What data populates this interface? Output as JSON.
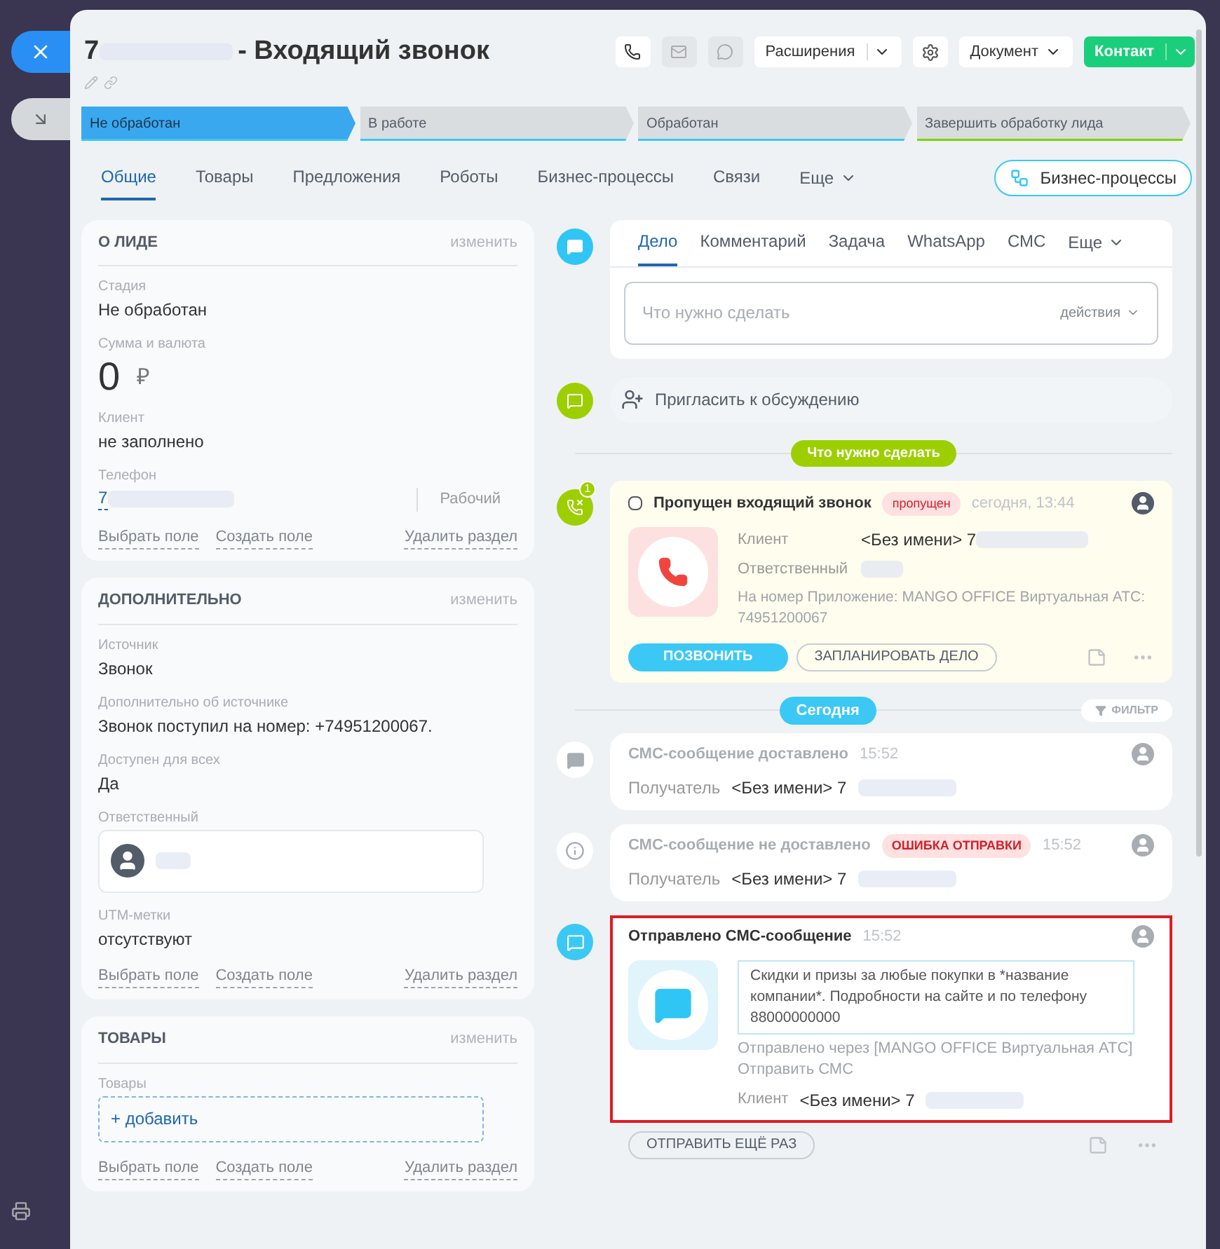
{
  "header": {
    "title_number": "7",
    "title": "- Входящий звонок",
    "extensions": "Расширения",
    "document": "Документ",
    "contact": "Контакт"
  },
  "stages": [
    {
      "label": "Не обработан",
      "selected": true,
      "color": "#3bc8f5"
    },
    {
      "label": "В работе",
      "selected": false,
      "color": "#3bc8f5"
    },
    {
      "label": "Обработан",
      "selected": false,
      "color": "#3bc8f5"
    },
    {
      "label": "Завершить обработку лида",
      "selected": false,
      "color": "#7bd500"
    }
  ],
  "tabs": [
    {
      "label": "Общие",
      "selected": true
    },
    {
      "label": "Товары",
      "selected": false
    },
    {
      "label": "Предложения",
      "selected": false
    },
    {
      "label": "Роботы",
      "selected": false
    },
    {
      "label": "Бизнес-процессы",
      "selected": false
    },
    {
      "label": "Связи",
      "selected": false
    }
  ],
  "tabs_more": "Еще",
  "bp_button": "Бизнес-процессы",
  "sections": [
    {
      "title": "О ЛИДЕ",
      "edit": "изменить",
      "fields": [
        {
          "kind": "text",
          "label": "Стадия",
          "value": "Не обработан"
        },
        {
          "kind": "money",
          "label": "Сумма и валюта",
          "value": "0",
          "currency": "₽"
        },
        {
          "kind": "text",
          "label": "Клиент",
          "value": "не заполнено"
        },
        {
          "kind": "phone",
          "label": "Телефон",
          "value": "7",
          "type": "Рабочий"
        }
      ],
      "footer": [
        "Выбрать поле",
        "Создать поле",
        "Удалить раздел"
      ]
    },
    {
      "title": "ДОПОЛНИТЕЛЬНО",
      "edit": "изменить",
      "fields": [
        {
          "kind": "text",
          "label": "Источник",
          "value": "Звонок"
        },
        {
          "kind": "text",
          "label": "Дополнительно об источнике",
          "value": "Звонок поступил на номер: +74951200067."
        },
        {
          "kind": "text",
          "label": "Доступен для всех",
          "value": "Да"
        },
        {
          "kind": "user",
          "label": "Ответственный"
        },
        {
          "kind": "text",
          "label": "UTM-метки",
          "value": "отсутствуют"
        }
      ],
      "footer": [
        "Выбрать поле",
        "Создать поле",
        "Удалить раздел"
      ]
    },
    {
      "title": "ТОВАРЫ",
      "edit": "изменить",
      "fields": [
        {
          "kind": "products",
          "label": "Товары",
          "value": "+ добавить"
        }
      ],
      "footer": [
        "Выбрать поле",
        "Создать поле",
        "Удалить раздел"
      ]
    }
  ],
  "composer": {
    "tabs": [
      {
        "label": "Дело",
        "selected": true
      },
      {
        "label": "Комментарий",
        "selected": false
      },
      {
        "label": "Задача",
        "selected": false
      },
      {
        "label": "WhatsApp",
        "selected": false
      },
      {
        "label": "СМС",
        "selected": false
      }
    ],
    "more": "Еще",
    "placeholder": "Что нужно сделать",
    "actions": "действия"
  },
  "invite": "Пригласить к обсуждению",
  "todo_divider": "Что нужно сделать",
  "call": {
    "counter": "1",
    "checked": false,
    "title": "Пропущен входящий звонок",
    "badge": "пропущен",
    "time": "сегодня, 13:44",
    "rows": [
      {
        "label": "Клиент",
        "value": "<Без имени> 7"
      },
      {
        "label": "Ответственный",
        "value": ""
      }
    ],
    "note": "На номер Приложение: MANGO OFFICE Виртуальная АТС: 74951200067",
    "call_button": "ПОЗВОНИТЬ",
    "plan_button": "ЗАПЛАНИРОВАТЬ ДЕЛО"
  },
  "today_divider": "Сегодня",
  "filter": "ФИЛЬТР",
  "events": [
    {
      "kind": "delivered",
      "title": "СМС-сообщение доставлено",
      "time": "15:52",
      "recipient_label": "Получатель",
      "recipient": "<Без имени> 7",
      "highlighted": false
    },
    {
      "kind": "failed",
      "title": "СМС-сообщение не доставлено",
      "badge": "ОШИБКА ОТПРАВКИ",
      "time": "15:52",
      "recipient_label": "Получатель",
      "recipient": "<Без имени> 7",
      "highlighted": false
    },
    {
      "kind": "sent",
      "title": "Отправлено СМС-сообщение",
      "time": "15:52",
      "message": "Скидки и призы за любые покупки в *название компании*. Подробности на сайте и по телефону 88000000000",
      "via": "Отправлено через [MANGO OFFICE Виртуальная АТС] Отправить СМС",
      "client_label": "Клиент",
      "client": "<Без имени> 7",
      "resend": "ОТПРАВИТЬ ЕЩЁ РАЗ",
      "highlighted": true
    }
  ]
}
